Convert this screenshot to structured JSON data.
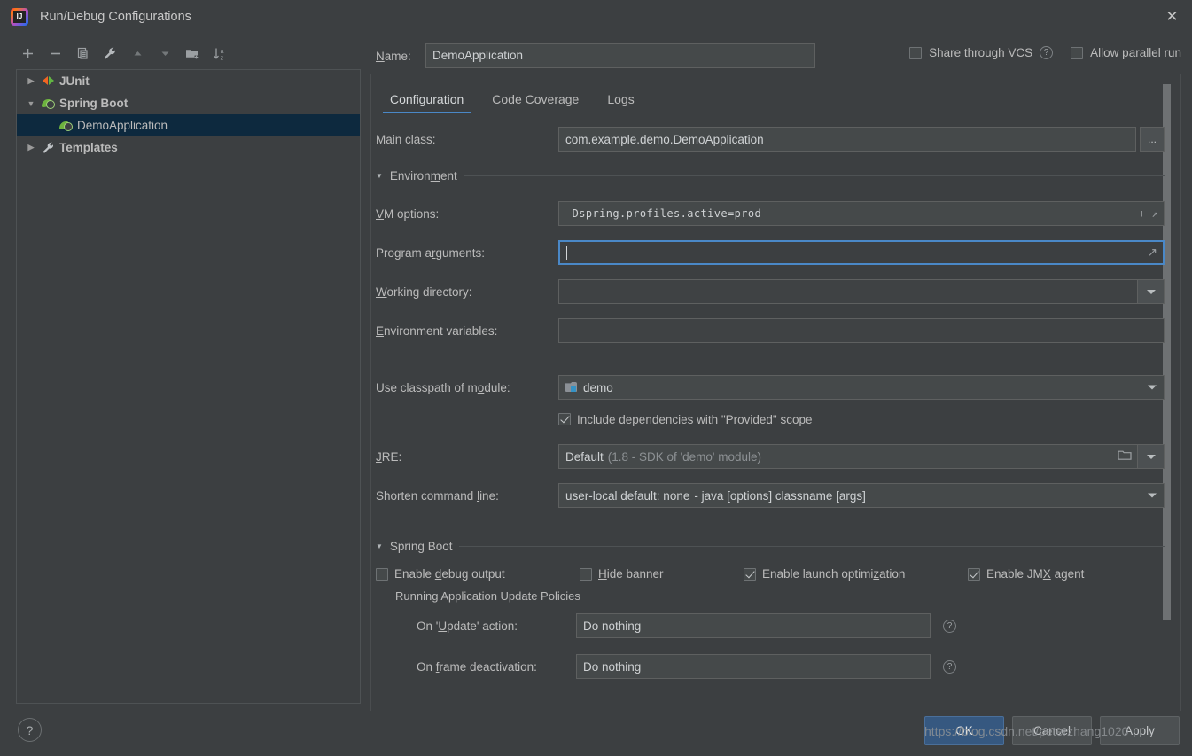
{
  "window": {
    "title": "Run/Debug Configurations",
    "logo_icon": "intellij-idea-logo",
    "close_icon": "close-icon"
  },
  "toolbar": {
    "buttons": [
      {
        "name": "add-configuration",
        "icon": "plus-icon"
      },
      {
        "name": "remove-configuration",
        "icon": "minus-icon"
      },
      {
        "name": "copy-configuration",
        "icon": "copy-icon"
      },
      {
        "name": "edit-templates",
        "icon": "wrench-icon"
      },
      {
        "name": "move-up",
        "icon": "arrow-up-icon"
      },
      {
        "name": "move-down",
        "icon": "arrow-down-icon"
      },
      {
        "name": "create-folder",
        "icon": "folder-add-icon"
      },
      {
        "name": "sort-configurations",
        "icon": "sort-az-icon"
      }
    ]
  },
  "tree": {
    "items": [
      {
        "label": "JUnit",
        "icon": "junit-icon",
        "expander": "collapsed",
        "depth": 0,
        "selected": false
      },
      {
        "label": "Spring Boot",
        "icon": "spring-boot-icon",
        "expander": "expanded",
        "depth": 0,
        "selected": false
      },
      {
        "label": "DemoApplication",
        "icon": "spring-boot-icon",
        "expander": "none",
        "depth": 1,
        "selected": true
      },
      {
        "label": "Templates",
        "icon": "wrench-icon",
        "expander": "collapsed",
        "depth": 0,
        "selected": false
      }
    ]
  },
  "help_button": {
    "label": "?",
    "icon": "help-icon"
  },
  "name_field": {
    "label": "Name:",
    "mnemonic": "N",
    "value": "DemoApplication"
  },
  "top_options": {
    "share_vcs": {
      "label": "Share through VCS",
      "mnemonic": "S",
      "checked": false,
      "help_icon": "help-icon"
    },
    "allow_parallel": {
      "label": "Allow parallel run",
      "mnemonic": "r",
      "checked": false
    }
  },
  "tabs": [
    {
      "label": "Configuration",
      "active": true
    },
    {
      "label": "Code Coverage",
      "active": false
    },
    {
      "label": "Logs",
      "active": false
    }
  ],
  "configuration": {
    "main_class": {
      "label": "Main class:",
      "value": "com.example.demo.DemoApplication",
      "browse_button": "..."
    },
    "environment_section": {
      "label": "Environment",
      "mnemonic": "m",
      "expanded": true
    },
    "vm_options": {
      "label": "VM options:",
      "mnemonic": "V",
      "value": "-Dspring.profiles.active=prod",
      "icons": [
        "plus-icon",
        "expand-icon"
      ]
    },
    "program_arguments": {
      "label": "Program arguments:",
      "mnemonic": "r",
      "value": "",
      "focused": true,
      "icons": [
        "expand-icon"
      ]
    },
    "working_directory": {
      "label": "Working directory:",
      "mnemonic": "W",
      "value": "",
      "icons": [
        "folder-icon",
        "dropdown-icon"
      ]
    },
    "environment_variables": {
      "label": "Environment variables:",
      "mnemonic": "E",
      "value": "",
      "icons": [
        "list-icon"
      ]
    },
    "classpath_module": {
      "label": "Use classpath of module:",
      "mnemonic": "o",
      "value": "demo",
      "icon": "module-icon"
    },
    "include_provided": {
      "label": "Include dependencies with \"Provided\" scope",
      "checked": true
    },
    "jre": {
      "label": "JRE:",
      "mnemonic": "J",
      "value": "Default",
      "value_hint": "(1.8 - SDK of 'demo' module)",
      "icons": [
        "folder-icon",
        "dropdown-icon"
      ]
    },
    "shorten_command_line": {
      "label": "Shorten command line:",
      "mnemonic": "l",
      "value": "user-local default: none",
      "value_hint": "- java [options] classname [args]"
    }
  },
  "spring_boot": {
    "section_label": "Spring Boot",
    "expanded": true,
    "checkboxes": [
      {
        "label": "Enable debug output",
        "mnemonic": "d",
        "checked": false
      },
      {
        "label": "Hide banner",
        "mnemonic": "H",
        "checked": false
      },
      {
        "label": "Enable launch optimization",
        "mnemonic": "z",
        "checked": true
      },
      {
        "label": "Enable JMX agent",
        "mnemonic": "X",
        "checked": true
      }
    ],
    "update_policies": {
      "section_label": "Running Application Update Policies",
      "rows": [
        {
          "label": "On 'Update' action:",
          "mnemonic": "U",
          "value": "Do nothing",
          "help_icon": "help-icon"
        },
        {
          "label": "On frame deactivation:",
          "mnemonic": "f",
          "value": "Do nothing",
          "help_icon": "help-icon"
        }
      ]
    }
  },
  "footer": {
    "ok": "OK",
    "cancel": "Cancel",
    "apply": "Apply"
  },
  "watermark": "https://blog.csdn.net/peterzhang1020"
}
